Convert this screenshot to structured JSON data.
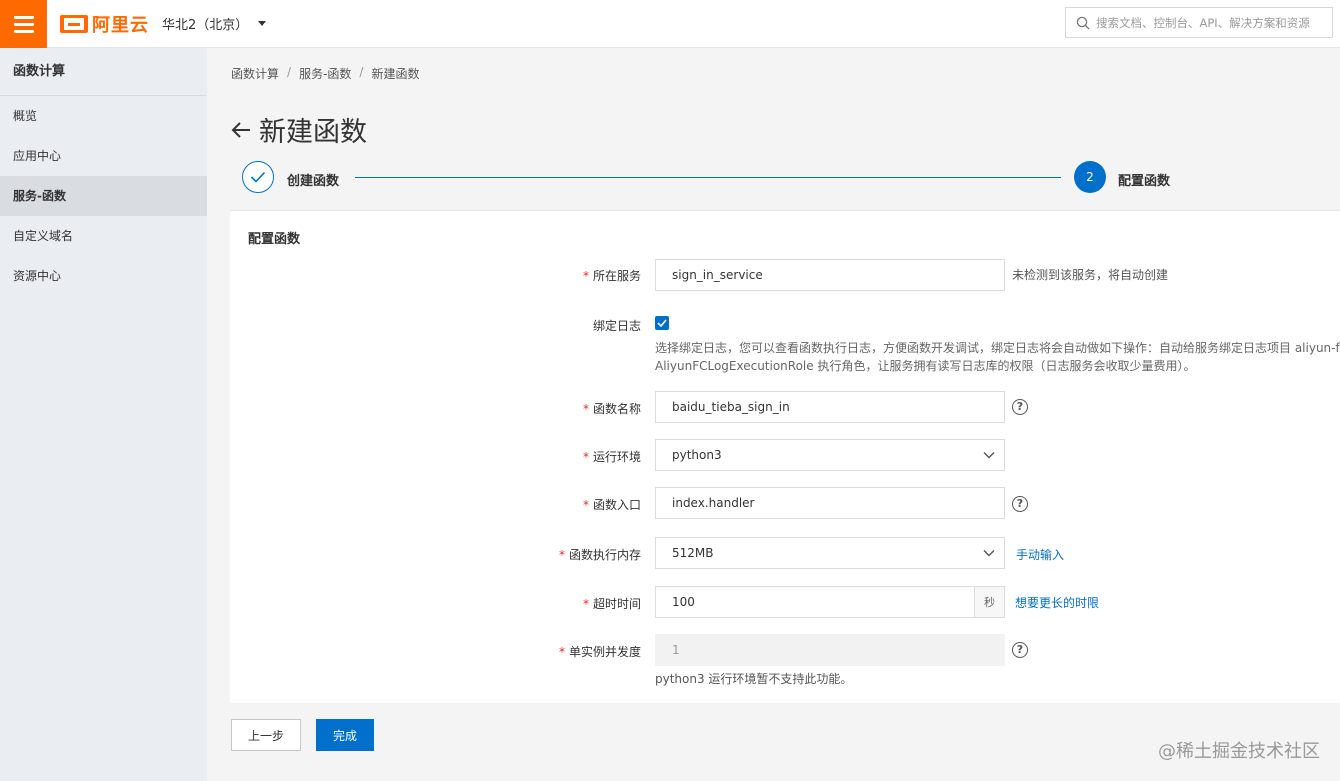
{
  "topbar": {
    "logo_text": "阿里云",
    "region": "华北2（北京）",
    "search_placeholder": "搜索文档、控制台、API、解决方案和资源"
  },
  "sidebar": {
    "title": "函数计算",
    "items": [
      {
        "label": "概览"
      },
      {
        "label": "应用中心"
      },
      {
        "label": "服务-函数"
      },
      {
        "label": "自定义域名"
      },
      {
        "label": "资源中心"
      }
    ],
    "active_index": 2
  },
  "breadcrumb": [
    "函数计算",
    "服务-函数",
    "新建函数"
  ],
  "breadcrumb_sep": "/",
  "page_title": "新建函数",
  "steps": {
    "step1_label": "创建函数",
    "step2_number": "2",
    "step2_label": "配置函数"
  },
  "panel": {
    "title": "配置函数",
    "service": {
      "label": "所在服务",
      "value": "sign_in_service",
      "hint": "未检测到该服务，将自动创建"
    },
    "bind_log": {
      "label": "绑定日志",
      "checked": true,
      "desc_line1": "选择绑定日志，您可以查看函数执行日志，方便函数开发调试，绑定日志将会自动做如下操作：自动给服务绑定日志项目 aliyun-fc",
      "desc_line2": "AliyunFCLogExecutionRole 执行角色，让服务拥有读写日志库的权限（日志服务会收取少量费用）。"
    },
    "function_name": {
      "label": "函数名称",
      "value": "baidu_tieba_sign_in"
    },
    "runtime": {
      "label": "运行环境",
      "value": "python3"
    },
    "handler": {
      "label": "函数入口",
      "value": "index.handler"
    },
    "memory": {
      "label": "函数执行内存",
      "value": "512MB",
      "link": "手动输入"
    },
    "timeout": {
      "label": "超时时间",
      "value": "100",
      "unit": "秒",
      "link": "想要更长的时限"
    },
    "concurrency": {
      "label": "单实例并发度",
      "value": "1",
      "hint": "python3 运行环境暂不支持此功能。"
    },
    "required_mark": "*",
    "help_mark": "?"
  },
  "buttons": {
    "prev": "上一步",
    "done": "完成"
  },
  "watermark": "@稀土掘金技术社区",
  "colors": {
    "brand_orange": "#ff6a00",
    "primary_blue": "#0070cc",
    "required_red": "#e72b2b"
  }
}
